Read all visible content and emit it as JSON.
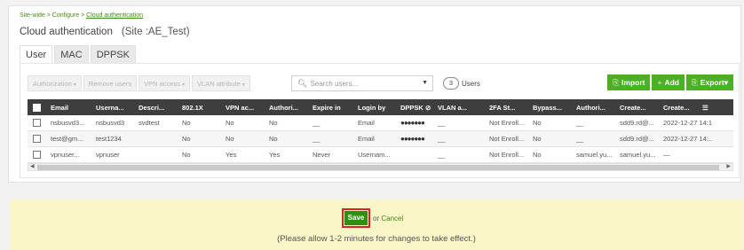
{
  "breadcrumb": {
    "part1": "Site-wide",
    "part2": "Configure",
    "part3": "Cloud authentication",
    "sep": ">"
  },
  "page": {
    "title": "Cloud authentication",
    "site": "(Site :AE_Test)"
  },
  "tabs": [
    "User",
    "MAC",
    "DPPSK"
  ],
  "toolbar": {
    "authorization": "Authorization",
    "remove_users": "Remove users",
    "vpn_access": "VPN access",
    "vlan_attribute": "VLAN attribute"
  },
  "search": {
    "placeholder": "Search users..."
  },
  "user_count": {
    "value": "3",
    "label": "Users"
  },
  "actions": {
    "import": "Import",
    "add": "Add",
    "export": "Export"
  },
  "table": {
    "headers": [
      "Email",
      "Userna...",
      "Descri...",
      "802.1X",
      "VPN ac...",
      "Authori...",
      "Expire in",
      "Login by",
      "DPPSK",
      "VLAN a...",
      "2FA St...",
      "Bypass...",
      "Authori...",
      "Create...",
      "Create..."
    ],
    "rows": [
      [
        "nsbusvd3...",
        "nsbusvd3",
        "svdtest",
        "No",
        "No",
        "No",
        "__",
        "Email",
        "●●●●●●●",
        "__",
        "Not Enroll...",
        "No",
        "__",
        "sdd9.rd@...",
        "2022-12-27 14:1"
      ],
      [
        "test@gm...",
        "test1234",
        "",
        "No",
        "No",
        "No",
        "__",
        "Email",
        "●●●●●●●",
        "__",
        "Not Enroll...",
        "No",
        "__",
        "sdd9.rd@...",
        "2022-12-27 14:.."
      ],
      [
        "vpnuser...",
        "vpnuser",
        "",
        "No",
        "Yes",
        "Yes",
        "Never",
        "Usernam...",
        "",
        "__",
        "Not Enroll...",
        "No",
        "samuel.yu...",
        "samuel.yu...",
        "—"
      ]
    ]
  },
  "footer": {
    "save": "Save",
    "or": "or",
    "cancel": "Cancel",
    "note": "(Please allow 1-2 minutes for changes to take effect.)"
  },
  "colors": {
    "accent_green": "#4caf26",
    "save_green": "#2f8f12",
    "highlight_red": "#dd2222",
    "footer_bg": "#fbf6c8"
  }
}
